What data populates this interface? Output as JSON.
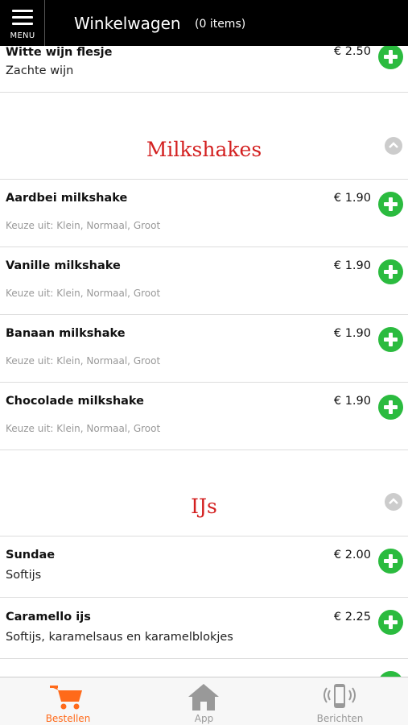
{
  "header": {
    "menu_label": "MENU",
    "title": "Winkelwagen",
    "cart_count": "(0 items)"
  },
  "top_item": {
    "name": "Witte wijn flesje",
    "description": "Zachte wijn",
    "price": "€ 2.50"
  },
  "sections": [
    {
      "title": "Milkshakes",
      "items": [
        {
          "name": "Aardbei milkshake",
          "options": "Keuze uit: Klein, Normaal, Groot",
          "price": "€ 1.90"
        },
        {
          "name": "Vanille milkshake",
          "options": "Keuze uit: Klein, Normaal, Groot",
          "price": "€ 1.90"
        },
        {
          "name": "Banaan milkshake",
          "options": "Keuze uit: Klein, Normaal, Groot",
          "price": "€ 1.90"
        },
        {
          "name": "Chocolade milkshake",
          "options": "Keuze uit: Klein, Normaal, Groot",
          "price": "€ 1.90"
        }
      ]
    },
    {
      "title": "IJs",
      "items": [
        {
          "name": "Sundae",
          "description": "Softijs",
          "price": "€ 2.00"
        },
        {
          "name": "Caramello ijs",
          "description": "Softijs, karamelsaus en karamelblokjes",
          "price": "€ 2.25"
        }
      ]
    }
  ],
  "nav": {
    "items": [
      {
        "label": "Bestellen",
        "icon": "cart-icon",
        "active": true
      },
      {
        "label": "App",
        "icon": "home-icon",
        "active": false
      },
      {
        "label": "Berichten",
        "icon": "phone-vibrate-icon",
        "active": false
      }
    ]
  },
  "colors": {
    "accent_green": "#2bbb3f",
    "section_red": "#d32020",
    "nav_active": "#ff6a1a",
    "header_bg": "#000000"
  }
}
